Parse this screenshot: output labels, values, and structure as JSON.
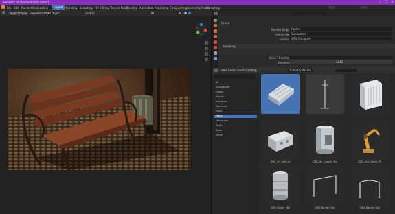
{
  "window": {
    "title": "Blender* [D:\\Assets\\Bench.blend]"
  },
  "menubar": {
    "items": [
      "File",
      "Edit",
      "Render",
      "Window",
      "Help"
    ],
    "workspaces": [
      "Layout",
      "Modeling",
      "Sculpting",
      "UV Editing",
      "Texture Paint",
      "Shading",
      "Animation",
      "Rendering",
      "Compositing",
      "Geometry Nodes",
      "Scripting"
    ],
    "active_workspace": "Layout"
  },
  "viewport": {
    "mode": "Object Mode",
    "menus": [
      "View",
      "Select",
      "Add",
      "Object"
    ],
    "transform": "Global",
    "gizmo_labels": {
      "x": "X",
      "y": "Y",
      "z": "Z"
    }
  },
  "properties": {
    "header_label": "Scene",
    "rows": [
      {
        "label": "Render Engine",
        "value": "Cycles"
      },
      {
        "label": "Feature Set",
        "value": "Supported"
      },
      {
        "label": "Device",
        "value": "GPU Compute"
      }
    ],
    "section": "Sampling",
    "rows2": [
      {
        "label": "Noise Threshold",
        "value": ""
      },
      {
        "label": "Samples",
        "value": "1024"
      }
    ]
  },
  "browser": {
    "menus": [
      "View",
      "Select",
      "Asset",
      "Catalog"
    ],
    "library": "Industry Assets",
    "search_placeholder": "",
    "tree": [
      {
        "label": "All",
        "selected": false
      },
      {
        "label": "Unassigned",
        "selected": false
      },
      {
        "label": "Crates",
        "selected": false
      },
      {
        "label": "Fences",
        "selected": false
      },
      {
        "label": "Industrial",
        "selected": false
      },
      {
        "label": "Machines",
        "selected": false
      },
      {
        "label": "Pipes",
        "selected": false
      },
      {
        "label": "Props",
        "selected": true
      },
      {
        "label": "Structures",
        "selected": false
      },
      {
        "label": "Tanks",
        "selected": false
      },
      {
        "label": "Tools",
        "selected": false
      },
      {
        "label": "Vents",
        "selected": false
      }
    ],
    "assets": [
      {
        "label": "",
        "selected": true,
        "kind": "cooler"
      },
      {
        "label": "",
        "selected": false,
        "kind": "pole"
      },
      {
        "label": "",
        "selected": false,
        "kind": "ac-unit"
      },
      {
        "label": "GRD_AC_Unit_Ac",
        "selected": false,
        "kind": "box-unit"
      },
      {
        "label": "GRD_Air_Compr_Sys",
        "selected": false,
        "kind": "compressor"
      },
      {
        "label": "GRD_Arm_Robot_Pr",
        "selected": false,
        "kind": "robot-arm"
      },
      {
        "label": "GRD_Barrel_Met",
        "selected": false,
        "kind": "barrel"
      },
      {
        "label": "GRD_Barrier_Met",
        "selected": false,
        "kind": "rail"
      },
      {
        "label": "GRD_Barrier_Rail",
        "selected": false,
        "kind": "rail2"
      }
    ]
  }
}
